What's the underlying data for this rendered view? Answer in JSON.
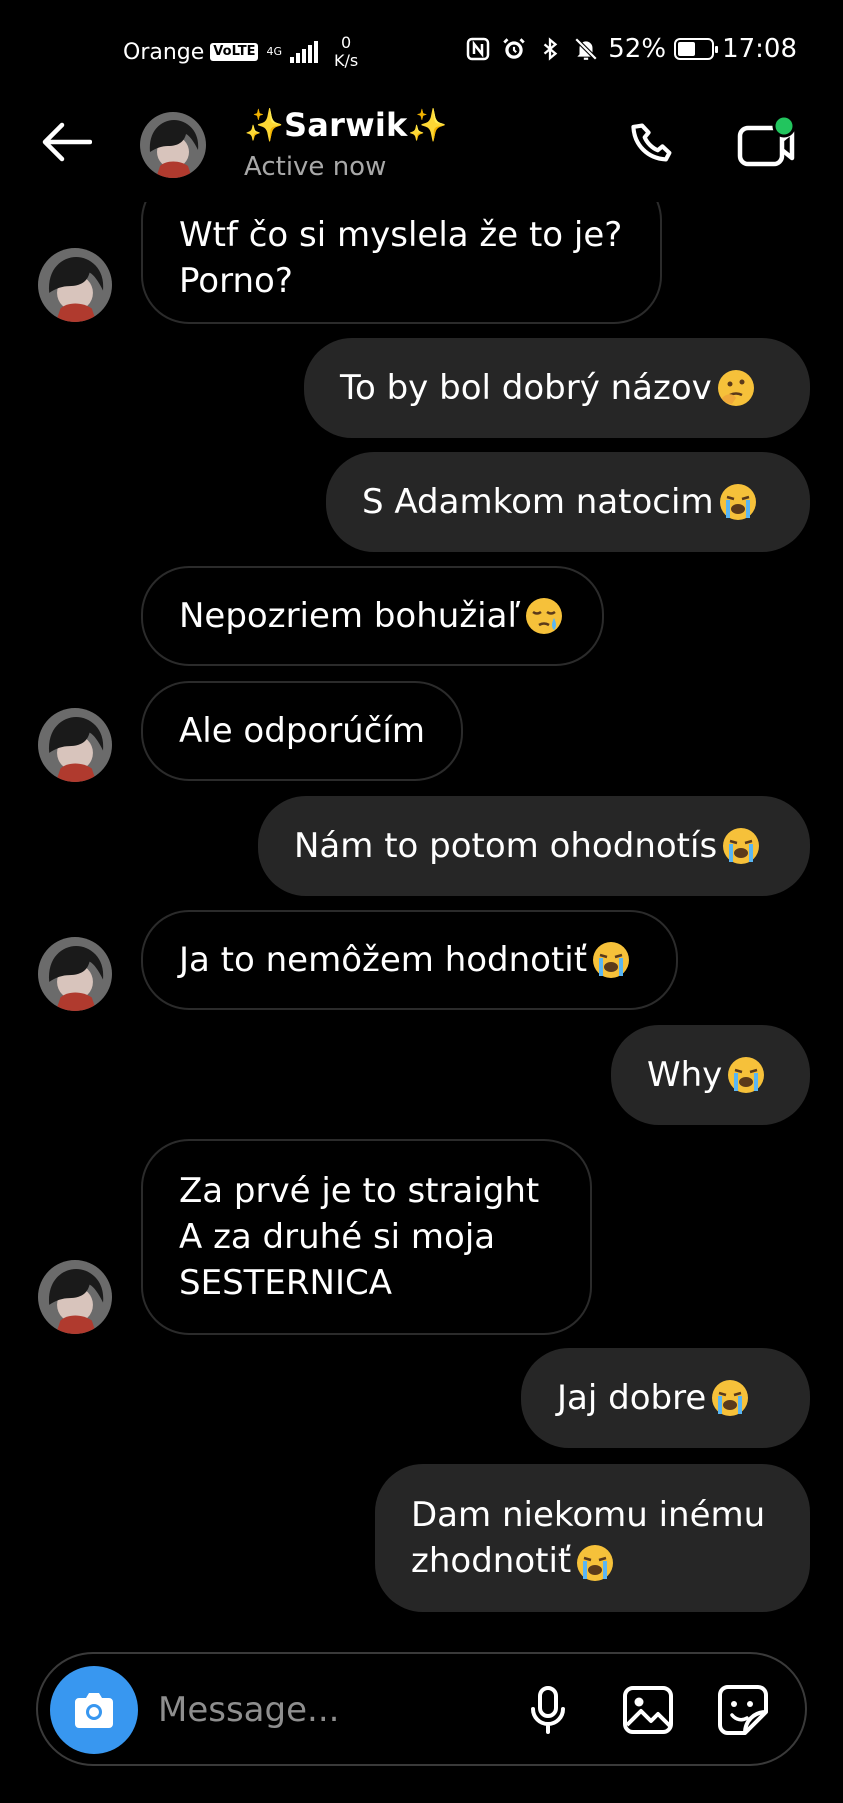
{
  "status_bar": {
    "carrier": "Orange",
    "volte": "VoLTE",
    "network": "4G",
    "speed_value": "0",
    "speed_unit": "K/s",
    "battery_percent": "52%",
    "battery_level": 0.52,
    "time": "17:08"
  },
  "header": {
    "name": "✨Sarwik✨",
    "status": "Active now",
    "online_color": "#22c55e"
  },
  "messages": [
    {
      "side": "in",
      "text": "Wtf čo si myslela že to je?\nPorno?"
    },
    {
      "side": "out",
      "text": "To by bol dobrý názov",
      "emoji": "thinking"
    },
    {
      "side": "out",
      "text": "S Adamkom natocim",
      "emoji": "crying"
    },
    {
      "side": "in",
      "text": "Nepozriem bohužiaľ",
      "emoji": "sleepy"
    },
    {
      "side": "in",
      "text": "Ale odporúčím"
    },
    {
      "side": "out",
      "text": "Nám to potom ohodnotís",
      "emoji": "crying"
    },
    {
      "side": "in",
      "text": "Ja to nemôžem hodnotiť",
      "emoji": "crying"
    },
    {
      "side": "out",
      "text": "Why",
      "emoji": "crying"
    },
    {
      "side": "in",
      "text": "Za prvé je to straight\nA za druhé si moja\nSESTERNICA"
    },
    {
      "side": "out",
      "text": "Jaj dobre",
      "emoji": "crying"
    },
    {
      "side": "out",
      "text": "Dam niekomu inému\nzhodnotiť",
      "emoji": "crying"
    }
  ],
  "composer": {
    "placeholder": "Message...",
    "camera_color": "#3897f0"
  },
  "icons": {
    "back": "arrow-left-icon",
    "call": "phone-icon",
    "video": "video-camera-icon",
    "camera": "camera-icon",
    "mic": "microphone-icon",
    "gallery": "image-icon",
    "sticker": "sticker-icon"
  }
}
